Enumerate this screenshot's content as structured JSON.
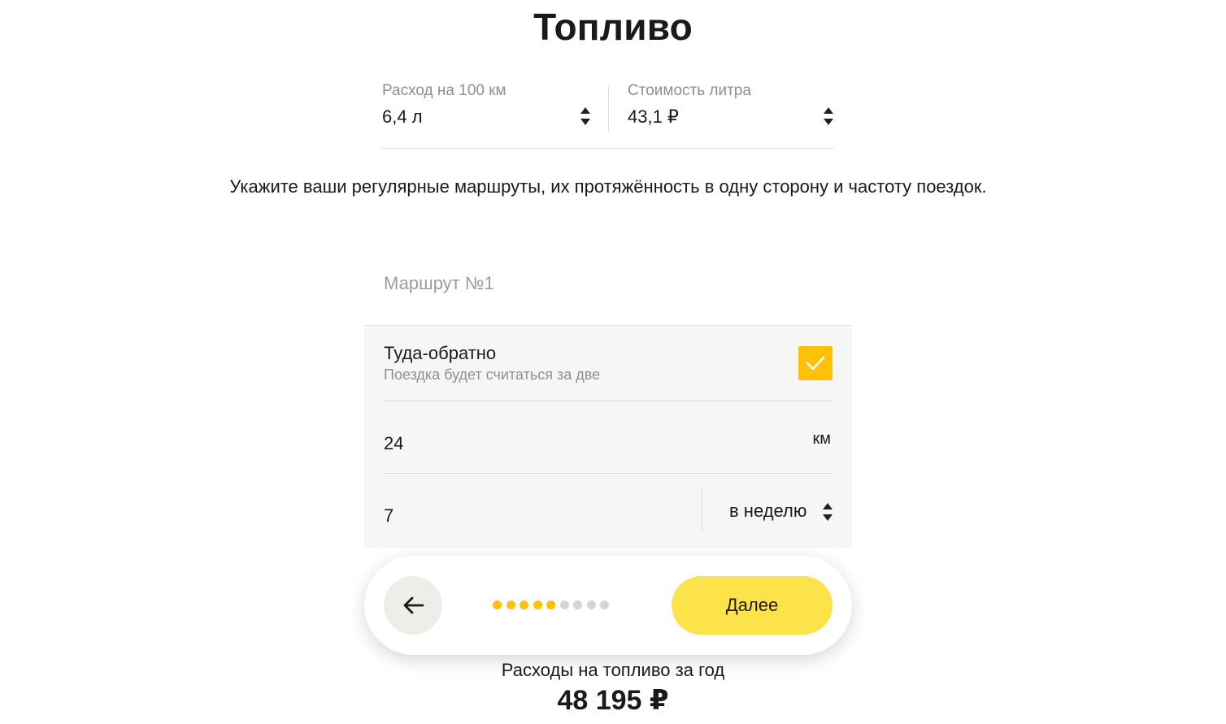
{
  "page": {
    "title": "Топливо"
  },
  "fuel": {
    "consumption_label": "Расход на 100 км",
    "consumption_value": "6,4 л",
    "price_label": "Стоимость литра",
    "price_value": "43,1 ₽"
  },
  "description": "Укажите ваши регулярные маршруты, их протяжённость в одну сторону и частоту поездок.",
  "route": {
    "title": "Маршрут №1",
    "round_trip_label": "Туда-обратно",
    "round_trip_hint": "Поездка будет считаться за две",
    "round_trip_checked": true,
    "distance_value": "24",
    "distance_unit": "км",
    "frequency_value": "7",
    "frequency_period": "в неделю"
  },
  "navigation": {
    "back_icon": "arrow-left-icon",
    "next_label": "Далее",
    "steps_total": 9,
    "steps_completed": 5
  },
  "summary": {
    "label": "Расходы на топливо за год",
    "value": "48 195 ₽"
  },
  "colors": {
    "accent": "#ffc107",
    "button": "#fce34a",
    "card_bg": "#f6f6f4",
    "dot_inactive": "#d4d4d4"
  }
}
